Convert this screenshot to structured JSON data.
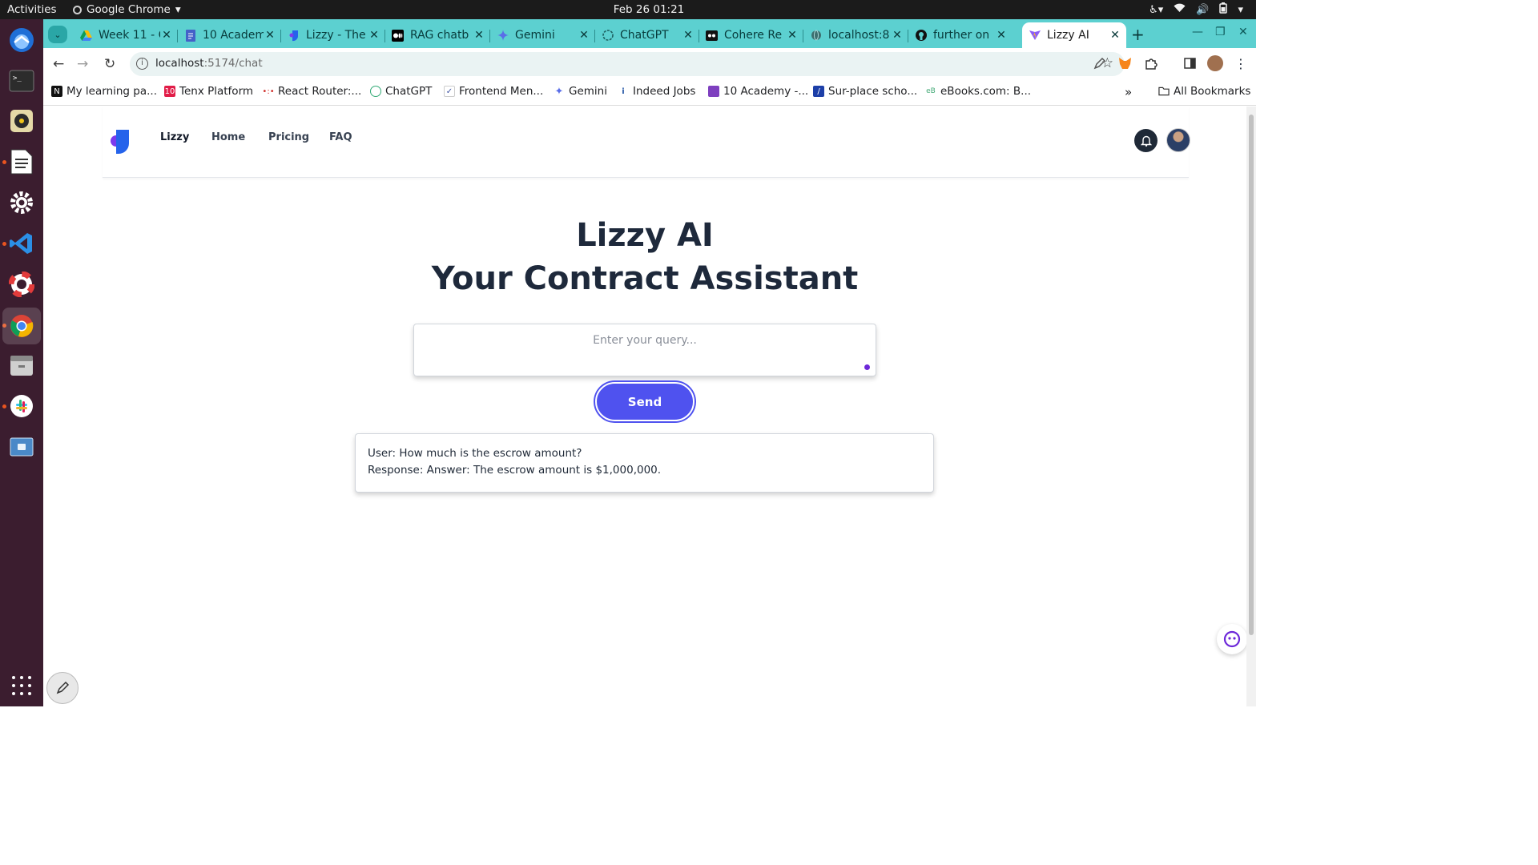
{
  "system": {
    "activities": "Activities",
    "app_name": "Google Chrome",
    "clock": "Feb 26  01:21"
  },
  "tabs": [
    {
      "title": "Week 11 - C",
      "icon": "google-drive-icon"
    },
    {
      "title": "10 Academ",
      "icon": "google-docs-icon"
    },
    {
      "title": "Lizzy - The",
      "icon": "lizzy-icon"
    },
    {
      "title": "RAG chatb",
      "icon": "medium-icon"
    },
    {
      "title": "Gemini",
      "icon": "gemini-icon"
    },
    {
      "title": "ChatGPT",
      "icon": "chatgpt-icon"
    },
    {
      "title": "Cohere Re",
      "icon": "cohere-icon"
    },
    {
      "title": "localhost:8",
      "icon": "globe-icon"
    },
    {
      "title": "further on",
      "icon": "github-icon"
    },
    {
      "title": "Lizzy AI",
      "icon": "vite-icon",
      "active": true
    }
  ],
  "address_bar": {
    "host": "localhost",
    "path": ":5174/chat"
  },
  "bookmarks": [
    {
      "label": "My learning pa...",
      "icon": "notion-icon"
    },
    {
      "label": "Tenx Platform",
      "icon": "tenx-icon"
    },
    {
      "label": "React Router:...",
      "icon": "react-router-icon"
    },
    {
      "label": "ChatGPT",
      "icon": "chatgpt-icon"
    },
    {
      "label": "Frontend Men...",
      "icon": "frontend-mentor-icon"
    },
    {
      "label": "Gemini",
      "icon": "gemini-icon"
    },
    {
      "label": "Indeed Jobs",
      "icon": "indeed-icon"
    },
    {
      "label": "10 Academy -...",
      "icon": "academy-icon"
    },
    {
      "label": "Sur-place scho...",
      "icon": "surplace-icon"
    },
    {
      "label": "eBooks.com: B...",
      "icon": "ebooks-icon"
    }
  ],
  "bookmarks_all": "All Bookmarks",
  "site": {
    "nav": {
      "brand": "Lizzy",
      "home": "Home",
      "pricing": "Pricing",
      "faq": "FAQ"
    },
    "hero_line1": "Lizzy AI",
    "hero_line2": "Your Contract Assistant",
    "query_placeholder": "Enter your query...",
    "send_label": "Send",
    "chat": {
      "user_line": "User: How much is the escrow amount?",
      "response_line": "Response: Answer: The escrow amount is $1,000,000."
    }
  },
  "colors": {
    "tabstrip": "#5cd0d0",
    "send_button": "#4f52ef",
    "heading": "#1e293b",
    "dock": "#3b1d2f"
  }
}
